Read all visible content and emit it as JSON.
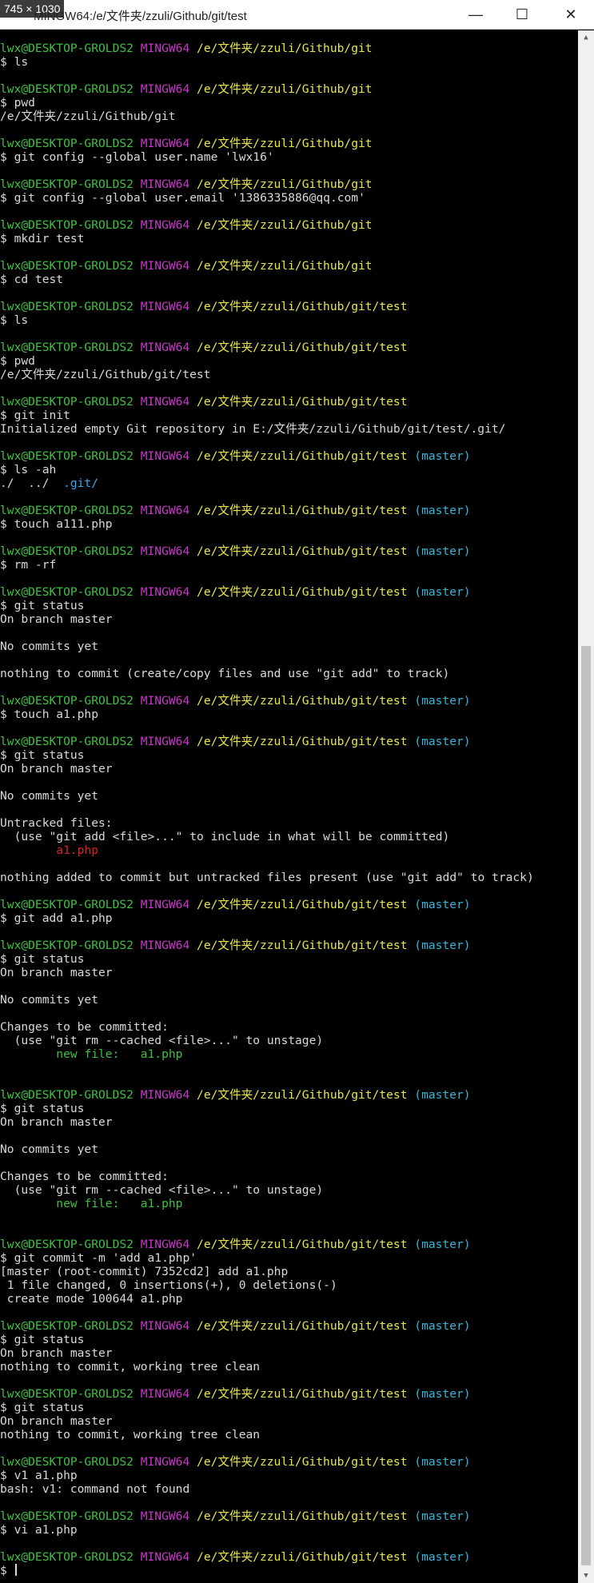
{
  "window": {
    "size_badge": "745 × 1030",
    "title": "MINGW64:/e/文件夹/zzuli/Github/git/test",
    "minimize_glyph": "—",
    "maximize_glyph": "☐",
    "close_glyph": "✕"
  },
  "prompt": {
    "user_host": "lwx@DESKTOP-GROLDS2",
    "shell": "MINGW64",
    "path_git": "/e/文件夹/zzuli/Github/git",
    "path_test": "/e/文件夹/zzuli/Github/git/test",
    "branch": "(master)"
  },
  "blocks": [
    {
      "path": "/e/文件夹/zzuli/Github/git",
      "branch": "",
      "cmd": "$ ls",
      "out": []
    },
    {
      "path": "/e/文件夹/zzuli/Github/git",
      "branch": "",
      "cmd": "$ pwd",
      "out": [
        {
          "t": "/e/文件夹/zzuli/Github/git"
        }
      ]
    },
    {
      "path": "/e/文件夹/zzuli/Github/git",
      "branch": "",
      "cmd": "$ git config --global user.name 'lwx16'",
      "out": []
    },
    {
      "path": "/e/文件夹/zzuli/Github/git",
      "branch": "",
      "cmd": "$ git config --global user.email '1386335886@qq.com'",
      "out": []
    },
    {
      "path": "/e/文件夹/zzuli/Github/git",
      "branch": "",
      "cmd": "$ mkdir test",
      "out": []
    },
    {
      "path": "/e/文件夹/zzuli/Github/git",
      "branch": "",
      "cmd": "$ cd test",
      "out": []
    },
    {
      "path": "/e/文件夹/zzuli/Github/git/test",
      "branch": "",
      "cmd": "$ ls",
      "out": []
    },
    {
      "path": "/e/文件夹/zzuli/Github/git/test",
      "branch": "",
      "cmd": "$ pwd",
      "out": [
        {
          "t": "/e/文件夹/zzuli/Github/git/test"
        }
      ]
    },
    {
      "path": "/e/文件夹/zzuli/Github/git/test",
      "branch": "",
      "cmd": "$ git init",
      "out": [
        {
          "t": "Initialized empty Git repository in E:/文件夹/zzuli/Github/git/test/.git/"
        }
      ]
    },
    {
      "path": "/e/文件夹/zzuli/Github/git/test",
      "branch": "(master)",
      "cmd": "$ ls -ah",
      "out": [
        {
          "t": "./  ../  ",
          "blue": ".git/"
        }
      ]
    },
    {
      "path": "/e/文件夹/zzuli/Github/git/test",
      "branch": "(master)",
      "cmd": "$ touch a111.php",
      "out": []
    },
    {
      "path": "/e/文件夹/zzuli/Github/git/test",
      "branch": "(master)",
      "cmd": "$ rm -rf",
      "out": []
    },
    {
      "path": "/e/文件夹/zzuli/Github/git/test",
      "branch": "(master)",
      "cmd": "$ git status",
      "out": [
        {
          "t": "On branch master"
        },
        {
          "t": ""
        },
        {
          "t": "No commits yet"
        },
        {
          "t": ""
        },
        {
          "t": "nothing to commit (create/copy files and use \"git add\" to track)"
        }
      ]
    },
    {
      "path": "/e/文件夹/zzuli/Github/git/test",
      "branch": "(master)",
      "cmd": "$ touch a1.php",
      "out": []
    },
    {
      "path": "/e/文件夹/zzuli/Github/git/test",
      "branch": "(master)",
      "cmd": "$ git status",
      "out": [
        {
          "t": "On branch master"
        },
        {
          "t": ""
        },
        {
          "t": "No commits yet"
        },
        {
          "t": ""
        },
        {
          "t": "Untracked files:"
        },
        {
          "t": "  (use \"git add <file>...\" to include in what will be committed)"
        },
        {
          "t": "        ",
          "red": "a1.php"
        },
        {
          "t": ""
        },
        {
          "t": "nothing added to commit but untracked files present (use \"git add\" to track)"
        }
      ]
    },
    {
      "path": "/e/文件夹/zzuli/Github/git/test",
      "branch": "(master)",
      "cmd": "$ git add a1.php",
      "out": []
    },
    {
      "path": "/e/文件夹/zzuli/Github/git/test",
      "branch": "(master)",
      "cmd": "$ git status",
      "out": [
        {
          "t": "On branch master"
        },
        {
          "t": ""
        },
        {
          "t": "No commits yet"
        },
        {
          "t": ""
        },
        {
          "t": "Changes to be committed:"
        },
        {
          "t": "  (use \"git rm --cached <file>...\" to unstage)"
        },
        {
          "t": "        ",
          "green": "new file:   a1.php"
        },
        {
          "t": ""
        }
      ]
    },
    {
      "path": "/e/文件夹/zzuli/Github/git/test",
      "branch": "(master)",
      "cmd": "$ git status",
      "out": [
        {
          "t": "On branch master"
        },
        {
          "t": ""
        },
        {
          "t": "No commits yet"
        },
        {
          "t": ""
        },
        {
          "t": "Changes to be committed:"
        },
        {
          "t": "  (use \"git rm --cached <file>...\" to unstage)"
        },
        {
          "t": "        ",
          "green": "new file:   a1.php"
        },
        {
          "t": ""
        }
      ]
    },
    {
      "path": "/e/文件夹/zzuli/Github/git/test",
      "branch": "(master)",
      "cmd": "$ git commit -m 'add a1.php'",
      "out": [
        {
          "t": "[master (root-commit) 7352cd2] add a1.php"
        },
        {
          "t": " 1 file changed, 0 insertions(+), 0 deletions(-)"
        },
        {
          "t": " create mode 100644 a1.php"
        }
      ]
    },
    {
      "path": "/e/文件夹/zzuli/Github/git/test",
      "branch": "(master)",
      "cmd": "$ git status",
      "out": [
        {
          "t": "On branch master"
        },
        {
          "t": "nothing to commit, working tree clean"
        }
      ]
    },
    {
      "path": "/e/文件夹/zzuli/Github/git/test",
      "branch": "(master)",
      "cmd": "$ git status",
      "out": [
        {
          "t": "On branch master"
        },
        {
          "t": "nothing to commit, working tree clean"
        }
      ]
    },
    {
      "path": "/e/文件夹/zzuli/Github/git/test",
      "branch": "(master)",
      "cmd": "$ v1 a1.php",
      "out": [
        {
          "t": "bash: v1: command not found"
        }
      ]
    },
    {
      "path": "/e/文件夹/zzuli/Github/git/test",
      "branch": "(master)",
      "cmd": "$ vi a1.php",
      "out": []
    },
    {
      "path": "/e/文件夹/zzuli/Github/git/test",
      "branch": "(master)",
      "cmd": "$ ",
      "out": [],
      "cursor": true
    }
  ]
}
